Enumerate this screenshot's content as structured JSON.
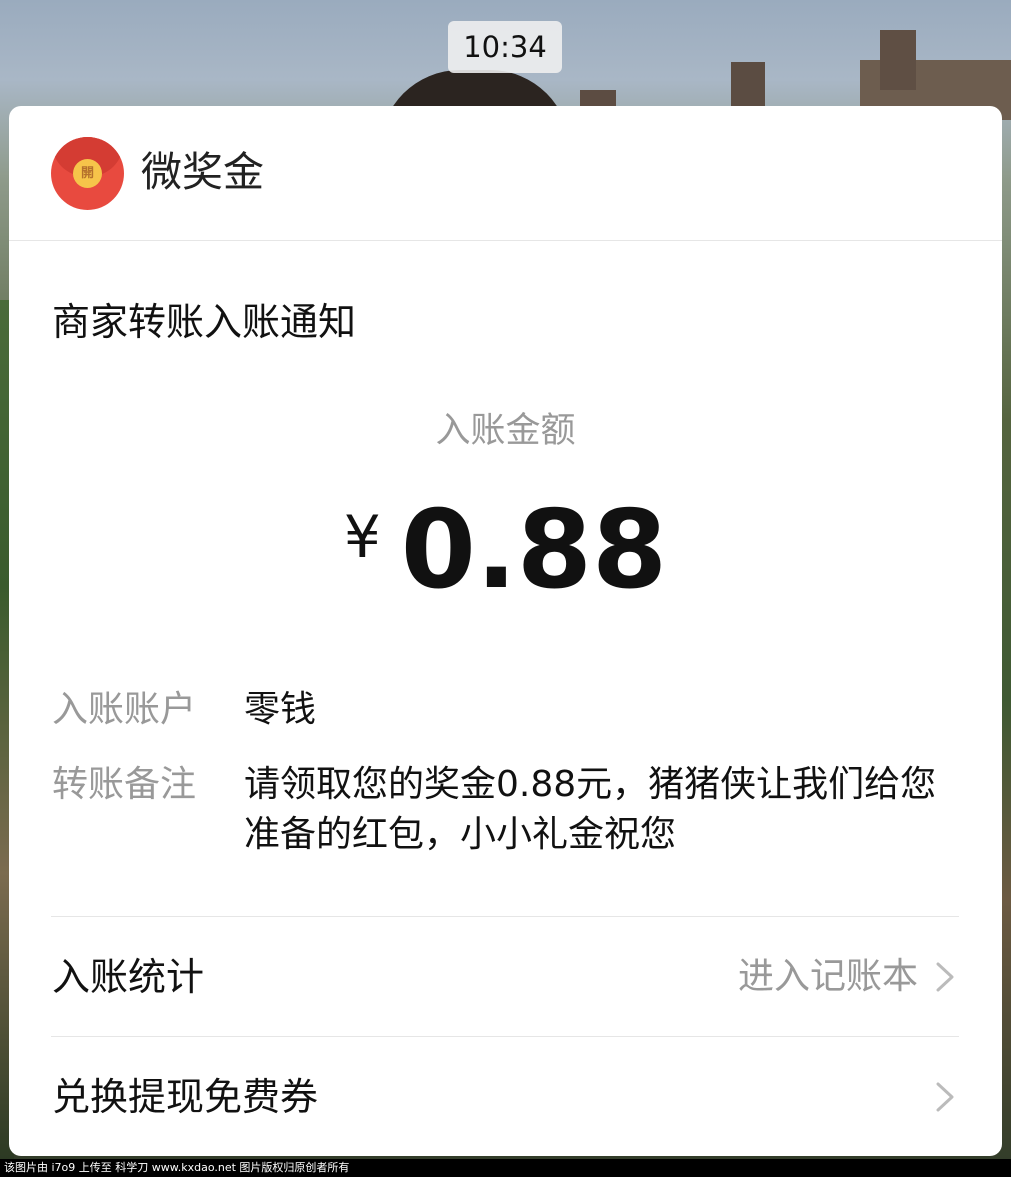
{
  "status_bar": {
    "time": "10:34"
  },
  "notification": {
    "app": {
      "name": "微奖金",
      "icon": "red-packet-icon",
      "icon_seal_text": "開"
    },
    "title": "商家转账入账通知",
    "amount": {
      "label": "入账金额",
      "currency": "¥",
      "value": "0.88"
    },
    "details": [
      {
        "label": "入账账户",
        "value": "零钱"
      },
      {
        "label": "转账备注",
        "value": "请领取您的奖金0.88元，猪猪侠让我们给您准备的红包，小小礼金祝您"
      }
    ],
    "rows": [
      {
        "label": "入账统计",
        "action": "进入记账本",
        "icon": "chevron-right-icon"
      },
      {
        "label": "兑换提现免费券",
        "action": "",
        "icon": "chevron-right-icon"
      }
    ]
  },
  "watermark": {
    "text": "该图片由 i7o9 上传至 科学刀 www.kxdao.net 图片版权归原创者所有"
  },
  "colors": {
    "card_bg": "#ffffff",
    "primary_text": "#111111",
    "secondary_text": "#999999",
    "divider": "#e6e6e6",
    "icon_red": "#e84a3f",
    "icon_gold": "#f6c44a"
  }
}
